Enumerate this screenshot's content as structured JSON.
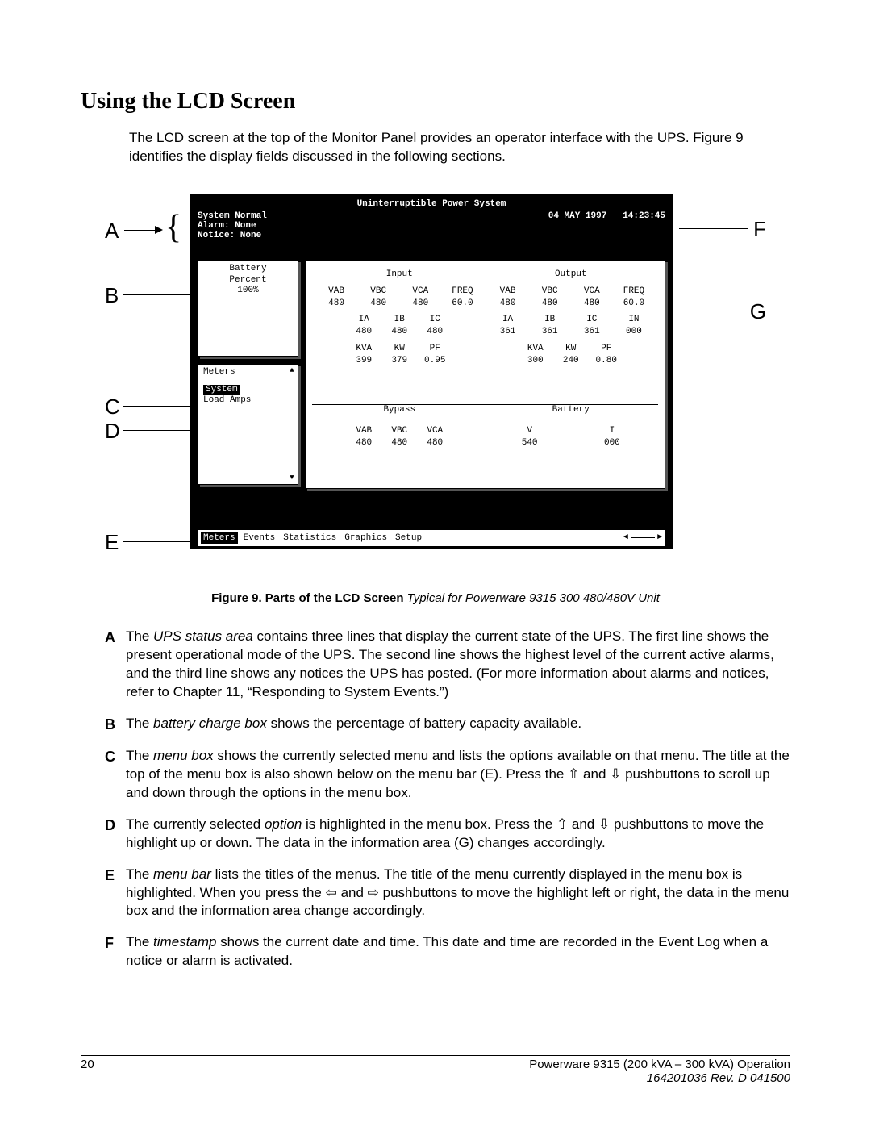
{
  "heading": "Using the LCD Screen",
  "intro": "The LCD screen at the top of the Monitor Panel provides an operator interface with the UPS.  Figure 9 identifies the display fields discussed in the following sections.",
  "callouts": {
    "A": "A",
    "B": "B",
    "C": "C",
    "D": "D",
    "E": "E",
    "F": "F",
    "G": "G"
  },
  "lcd": {
    "title": "Uninterruptible Power System",
    "status1": "System Normal",
    "status2": "Alarm:  None",
    "status3": "Notice: None",
    "date": "04 MAY 1997",
    "time": "14:23:45",
    "battery": {
      "line1": "Battery",
      "line2": "Percent",
      "line3": "100%"
    },
    "menu": {
      "title": "Meters",
      "items": [
        "System",
        "Load Amps"
      ],
      "selectedIndex": 0
    },
    "info": {
      "input": {
        "title": "Input",
        "h1": [
          "VAB",
          "VBC",
          "VCA",
          "FREQ"
        ],
        "v1": [
          "480",
          "480",
          "480",
          "60.0"
        ],
        "h2": [
          "IA",
          "IB",
          "IC"
        ],
        "v2": [
          "480",
          "480",
          "480"
        ],
        "h3": [
          "KVA",
          "KW",
          "PF"
        ],
        "v3": [
          "399",
          "379",
          "0.95"
        ]
      },
      "output": {
        "title": "Output",
        "h1": [
          "VAB",
          "VBC",
          "VCA",
          "FREQ"
        ],
        "v1": [
          "480",
          "480",
          "480",
          "60.0"
        ],
        "h2": [
          "IA",
          "IB",
          "IC",
          "IN"
        ],
        "v2": [
          "361",
          "361",
          "361",
          "000"
        ],
        "h3": [
          "KVA",
          "KW",
          "PF"
        ],
        "v3": [
          "300",
          "240",
          "0.80"
        ]
      },
      "bypass": {
        "title": "Bypass",
        "h1": [
          "VAB",
          "VBC",
          "VCA"
        ],
        "v1": [
          "480",
          "480",
          "480"
        ]
      },
      "battery": {
        "title": "Battery",
        "h1": [
          "V",
          "I"
        ],
        "v1": [
          "540",
          "000"
        ]
      }
    },
    "menubar": [
      "Meters",
      "Events",
      "Statistics",
      "Graphics",
      "Setup"
    ],
    "menubar_selected": 0
  },
  "caption_bold": "Figure 9.  Parts of the LCD Screen",
  "caption_ital": " Typical for Powerware 9315 300 480/480V Unit",
  "defs": {
    "A": {
      "lead": "The ",
      "term": "UPS status area ",
      "rest": "contains three lines that display the current state of the UPS.  The first line shows the present operational mode of the UPS.  The second line shows the highest level of the current active alarms, and the third line shows any notices the UPS has posted.  (For more information about alarms and notices, refer to Chapter 11, “Responding to System Events.”)"
    },
    "B": {
      "lead": "The ",
      "term": "battery charge box ",
      "rest": "shows the percentage of battery capacity available."
    },
    "C": {
      "lead": "The ",
      "term": "menu box ",
      "rest": "shows the currently selected menu and lists the options available on that menu.  The title at the top of the menu box is also shown below on the menu bar (E).  Press the ⇧ and ⇩ pushbuttons to scroll up and down through the options in the menu box."
    },
    "D": {
      "lead": "The currently selected ",
      "term": "option ",
      "rest": "is highlighted in the menu box.  Press the ⇧ and ⇩ pushbuttons to move the highlight up or down. The data in the information area (G) changes accordingly."
    },
    "E": {
      "lead": "The ",
      "term": "menu bar ",
      "rest": "lists the titles of the menus.  The title of the menu currently displayed in the menu box is highlighted.  When you press the  ⇦  and  ⇨  pushbuttons to move the highlight left or right, the data in the menu box and the information area change accordingly."
    },
    "F": {
      "lead": "The ",
      "term": "timestamp ",
      "rest": "shows the current date and time.  This date and time are recorded in the Event Log when a notice or alarm is activated."
    }
  },
  "footer": {
    "page": "20",
    "right1": "Powerware 9315 (200 kVA – 300 kVA) Operation",
    "right2": "164201036  Rev. D  041500"
  }
}
